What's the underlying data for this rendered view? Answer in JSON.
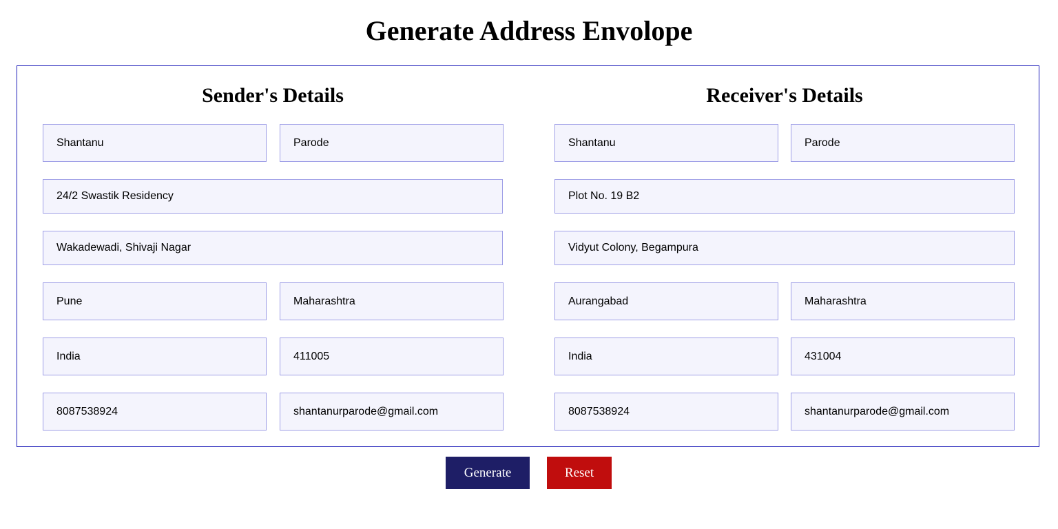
{
  "page": {
    "title": "Generate Address Envolope"
  },
  "sender": {
    "heading": "Sender's Details",
    "first_name": "Shantanu",
    "last_name": "Parode",
    "address_line1": "24/2 Swastik Residency",
    "address_line2": "Wakadewadi, Shivaji Nagar",
    "city": "Pune",
    "state": "Maharashtra",
    "country": "India",
    "pincode": "411005",
    "phone": "8087538924",
    "email": "shantanurparode@gmail.com"
  },
  "receiver": {
    "heading": "Receiver's Details",
    "first_name": "Shantanu",
    "last_name": "Parode",
    "address_line1": "Plot No. 19 B2",
    "address_line2": "Vidyut Colony, Begampura",
    "city": "Aurangabad",
    "state": "Maharashtra",
    "country": "India",
    "pincode": "431004",
    "phone": "8087538924",
    "email": "shantanurparode@gmail.com"
  },
  "actions": {
    "generate_label": "Generate",
    "reset_label": "Reset"
  },
  "colors": {
    "border": "#1a1ab8",
    "field_background": "#f4f4fd",
    "generate_button": "#1e1e66",
    "reset_button": "#c00d0d"
  }
}
